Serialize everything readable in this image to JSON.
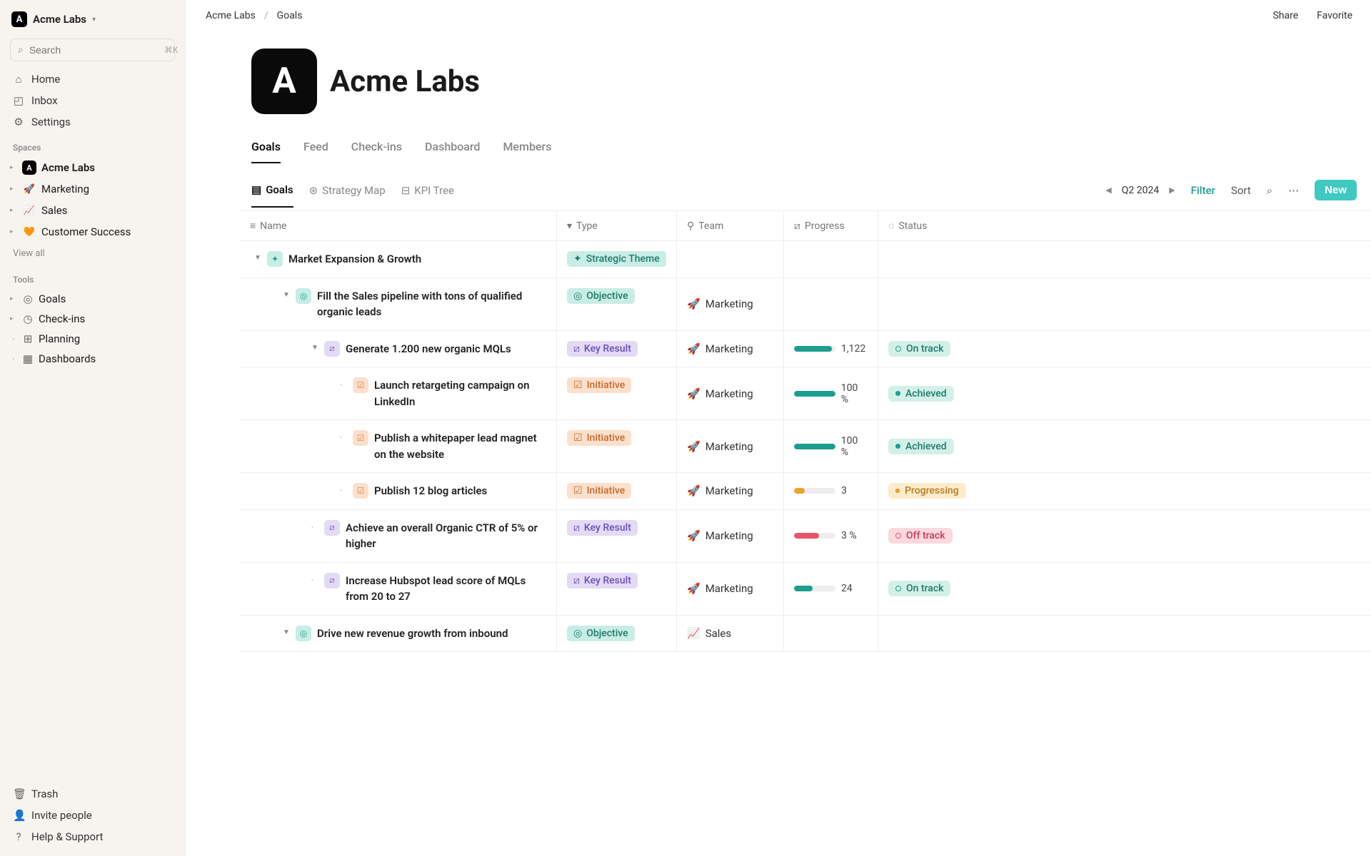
{
  "workspace": {
    "name": "Acme Labs"
  },
  "search": {
    "placeholder": "Search",
    "shortcut": "⌘K"
  },
  "nav": {
    "home": "Home",
    "inbox": "Inbox",
    "settings": "Settings"
  },
  "sections": {
    "spaces_label": "Spaces",
    "tools_label": "Tools",
    "view_all": "View all"
  },
  "spaces": [
    {
      "name": "Acme Labs",
      "bold": true,
      "logo": "A"
    },
    {
      "name": "Marketing",
      "emoji": "🚀"
    },
    {
      "name": "Sales",
      "emoji": "📈"
    },
    {
      "name": "Customer Success",
      "emoji": "🧡"
    }
  ],
  "tools": [
    {
      "name": "Goals",
      "icon": "target"
    },
    {
      "name": "Check-ins",
      "icon": "clock"
    },
    {
      "name": "Planning",
      "icon": "map"
    },
    {
      "name": "Dashboards",
      "icon": "grid"
    }
  ],
  "footer": {
    "trash": "Trash",
    "invite": "Invite people",
    "help": "Help & Support"
  },
  "breadcrumb": {
    "root": "Acme Labs",
    "current": "Goals"
  },
  "top_actions": {
    "share": "Share",
    "favorite": "Favorite"
  },
  "page": {
    "title": "Acme Labs"
  },
  "tabs": [
    "Goals",
    "Feed",
    "Check-ins",
    "Dashboard",
    "Members"
  ],
  "views": [
    "Goals",
    "Strategy Map",
    "KPI Tree"
  ],
  "period": "Q2 2024",
  "toolbar": {
    "filter": "Filter",
    "sort": "Sort",
    "new": "New"
  },
  "columns": {
    "name": "Name",
    "type": "Type",
    "team": "Team",
    "progress": "Progress",
    "status": "Status"
  },
  "type_labels": {
    "theme": "Strategic Theme",
    "objective": "Objective",
    "kr": "Key Result",
    "initiative": "Initiative"
  },
  "teams": {
    "marketing": {
      "label": "Marketing",
      "emoji": "🚀"
    },
    "sales": {
      "label": "Sales",
      "emoji": "📈"
    }
  },
  "status_labels": {
    "on_track": "On track",
    "achieved": "Achieved",
    "progressing": "Progressing",
    "off_track": "Off track"
  },
  "rows": [
    {
      "name": "Market Expansion & Growth",
      "type": "theme",
      "indent": 0,
      "caret": true
    },
    {
      "name": "Fill the Sales pipeline with tons of qualified organic leads",
      "type": "objective",
      "team": "marketing",
      "indent": 1,
      "caret": true
    },
    {
      "name": "Generate 1.200 new organic MQLs",
      "type": "kr",
      "team": "marketing",
      "indent": 2,
      "caret": true,
      "progress": {
        "pct": 92,
        "label": "1,122",
        "color": "green"
      },
      "status": "on_track"
    },
    {
      "name": "Launch retargeting campaign on LinkedIn",
      "type": "initiative",
      "team": "marketing",
      "indent": 3,
      "progress": {
        "pct": 100,
        "label": "100 %",
        "color": "green"
      },
      "status": "achieved"
    },
    {
      "name": "Publish a whitepaper lead magnet on the website",
      "type": "initiative",
      "team": "marketing",
      "indent": 3,
      "progress": {
        "pct": 100,
        "label": "100 %",
        "color": "green"
      },
      "status": "achieved"
    },
    {
      "name": "Publish 12 blog articles",
      "type": "initiative",
      "team": "marketing",
      "indent": 3,
      "progress": {
        "pct": 25,
        "label": "3",
        "color": "orange"
      },
      "status": "progressing"
    },
    {
      "name": "Achieve an overall Organic CTR of 5% or higher",
      "type": "kr",
      "team": "marketing",
      "indent": 2,
      "progress": {
        "pct": 60,
        "label": "3 %",
        "color": "red"
      },
      "status": "off_track"
    },
    {
      "name": "Increase Hubspot lead score of MQLs from 20 to 27",
      "type": "kr",
      "team": "marketing",
      "indent": 2,
      "progress": {
        "pct": 45,
        "label": "24",
        "color": "green"
      },
      "status": "on_track"
    },
    {
      "name": "Drive new revenue growth from inbound",
      "type": "objective",
      "team": "sales",
      "indent": 1,
      "caret": true
    }
  ]
}
